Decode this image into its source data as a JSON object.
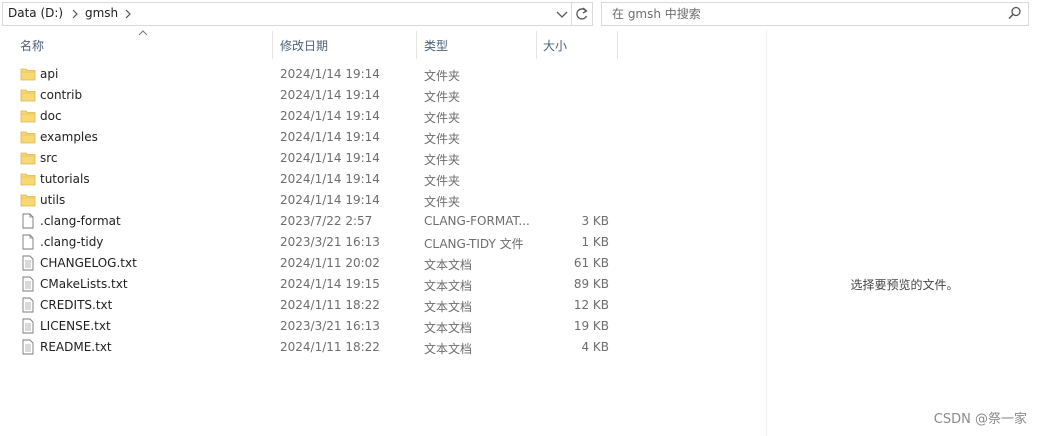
{
  "address": {
    "crumbs": [
      "Data (D:)",
      "gmsh"
    ]
  },
  "search": {
    "placeholder": "在 gmsh 中搜索"
  },
  "columns": {
    "name": "名称",
    "date": "修改日期",
    "type": "类型",
    "size": "大小"
  },
  "files": [
    {
      "name": "api",
      "date": "2024/1/14 19:14",
      "type": "文件夹",
      "size": "",
      "icon": "folder-icon"
    },
    {
      "name": "contrib",
      "date": "2024/1/14 19:14",
      "type": "文件夹",
      "size": "",
      "icon": "folder-icon"
    },
    {
      "name": "doc",
      "date": "2024/1/14 19:14",
      "type": "文件夹",
      "size": "",
      "icon": "folder-icon"
    },
    {
      "name": "examples",
      "date": "2024/1/14 19:14",
      "type": "文件夹",
      "size": "",
      "icon": "folder-icon"
    },
    {
      "name": "src",
      "date": "2024/1/14 19:14",
      "type": "文件夹",
      "size": "",
      "icon": "folder-icon"
    },
    {
      "name": "tutorials",
      "date": "2024/1/14 19:14",
      "type": "文件夹",
      "size": "",
      "icon": "folder-icon"
    },
    {
      "name": "utils",
      "date": "2024/1/14 19:14",
      "type": "文件夹",
      "size": "",
      "icon": "folder-icon"
    },
    {
      "name": ".clang-format",
      "date": "2023/7/22 2:57",
      "type": "CLANG-FORMAT...",
      "size": "3 KB",
      "icon": "blank-file-icon"
    },
    {
      "name": ".clang-tidy",
      "date": "2023/3/21 16:13",
      "type": "CLANG-TIDY 文件",
      "size": "1 KB",
      "icon": "blank-file-icon"
    },
    {
      "name": "CHANGELOG.txt",
      "date": "2024/1/11 20:02",
      "type": "文本文档",
      "size": "61 KB",
      "icon": "text-file-icon"
    },
    {
      "name": "CMakeLists.txt",
      "date": "2024/1/14 19:15",
      "type": "文本文档",
      "size": "89 KB",
      "icon": "text-file-icon"
    },
    {
      "name": "CREDITS.txt",
      "date": "2024/1/11 18:22",
      "type": "文本文档",
      "size": "12 KB",
      "icon": "text-file-icon"
    },
    {
      "name": "LICENSE.txt",
      "date": "2023/3/21 16:13",
      "type": "文本文档",
      "size": "19 KB",
      "icon": "text-file-icon"
    },
    {
      "name": "README.txt",
      "date": "2024/1/11 18:22",
      "type": "文本文档",
      "size": "4 KB",
      "icon": "text-file-icon"
    }
  ],
  "preview": {
    "message": "选择要预览的文件。"
  },
  "watermark": "CSDN @祭一家",
  "colors": {
    "folder": "#f8d775",
    "header_text": "#4c607a",
    "border": "#d9d9d9"
  }
}
